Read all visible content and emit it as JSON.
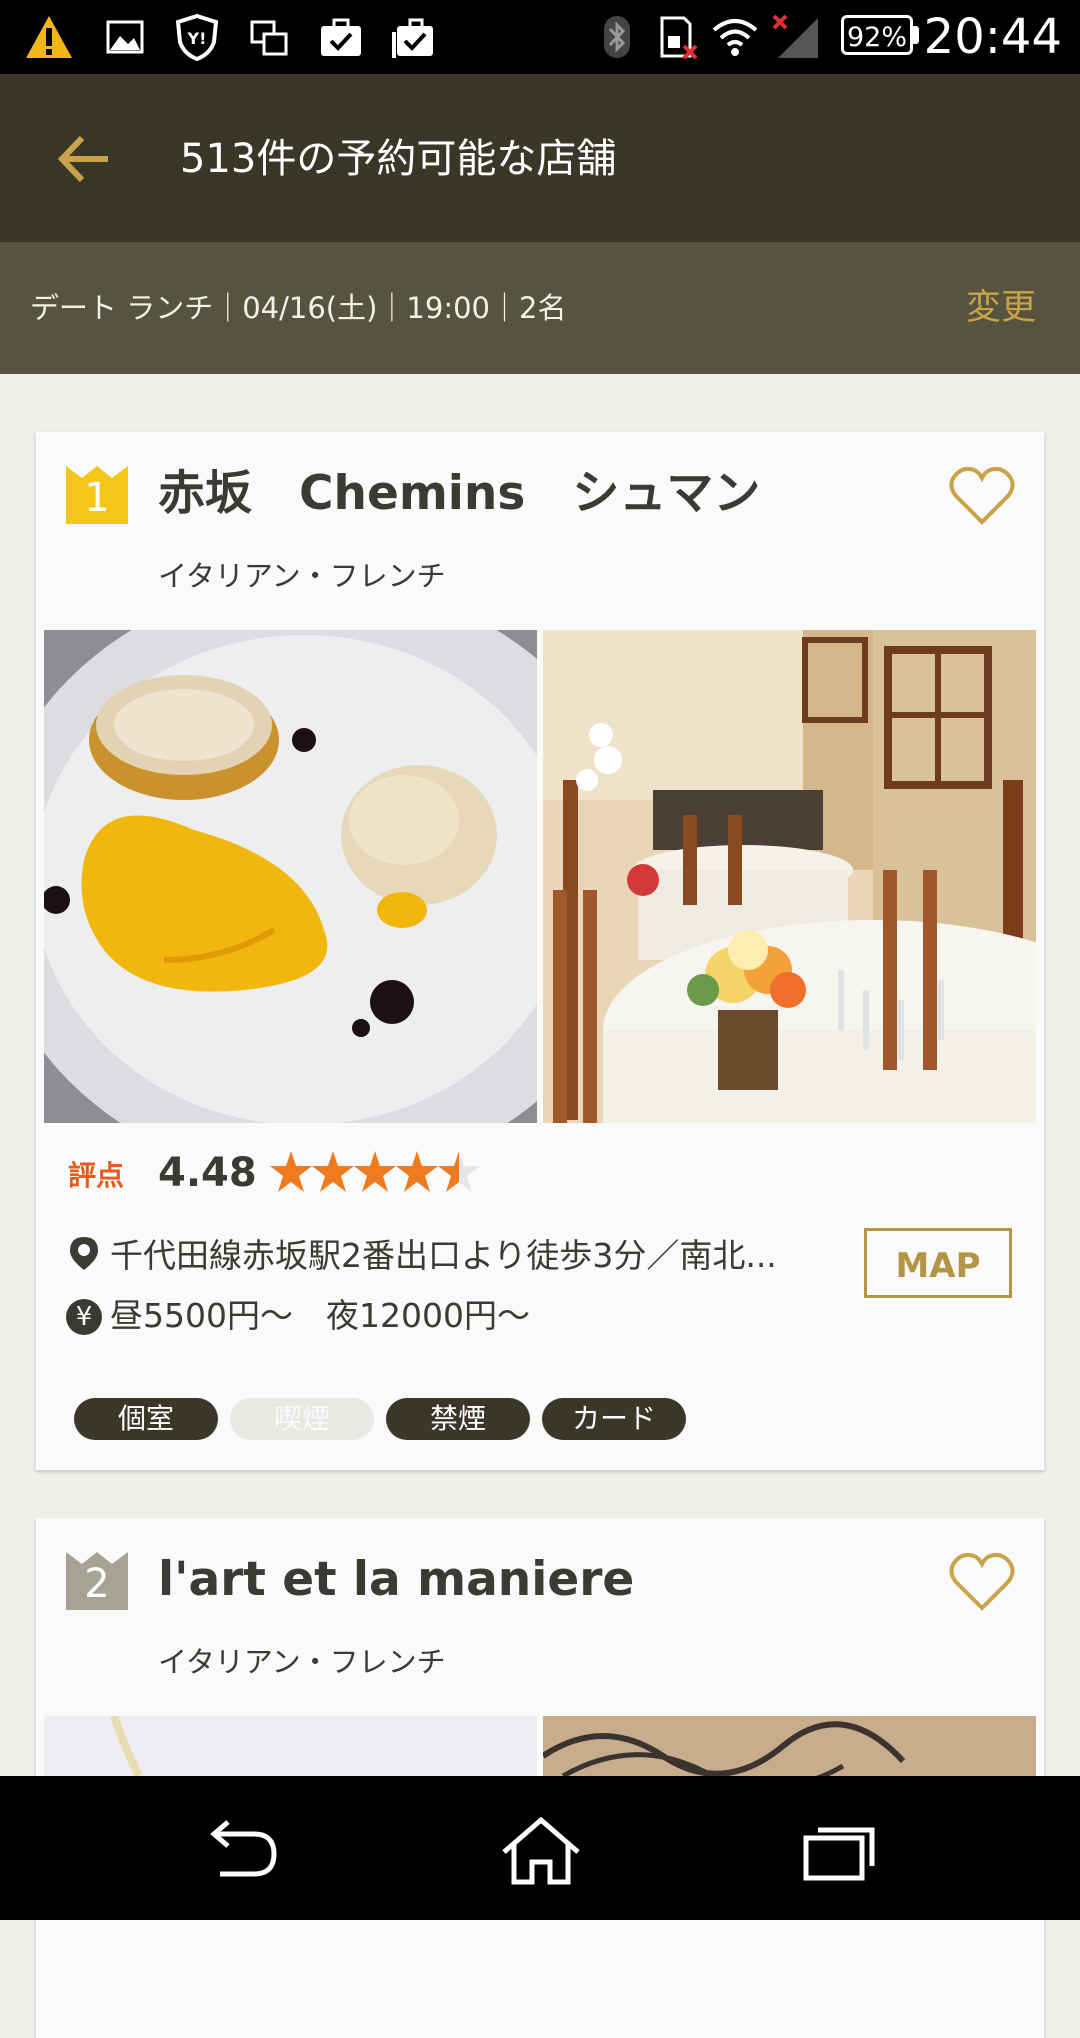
{
  "status_bar": {
    "battery": "92%",
    "time": "20:44",
    "icons": [
      "warning-icon",
      "image-icon",
      "yahoo-shield-icon",
      "screen-mirror-icon",
      "briefcase-check-icon",
      "clipboard-check-icon",
      "bluetooth-icon",
      "sd-card-error-icon",
      "wifi-icon",
      "signal-off-icon"
    ]
  },
  "app_bar": {
    "title": "513件の予約可能な店舗"
  },
  "filter_bar": {
    "summary": "デート ランチ｜04/16(土)｜19:00｜2名",
    "change_label": "変更"
  },
  "restaurants": [
    {
      "rank": "1",
      "name": "赤坂　Chemins　シュマン",
      "genre": "イタリアン・フレンチ",
      "rating_label": "評点",
      "rating": "4.48",
      "rating_value": 4.48,
      "access": "千代田線赤坂駅2番出口より徒歩3分／南北...",
      "price": "昼5500円～　夜12000円～",
      "map_label": "MAP",
      "tags": [
        {
          "label": "個室",
          "active": true
        },
        {
          "label": "喫煙",
          "active": false
        },
        {
          "label": "禁煙",
          "active": true
        },
        {
          "label": "カード",
          "active": true
        }
      ]
    },
    {
      "rank": "2",
      "name": "l'art et la maniere",
      "genre": "イタリアン・フレンチ"
    }
  ],
  "colors": {
    "app_bar": "#3a3729",
    "filter_bar": "#56533f",
    "accent_gold": "#c9a349",
    "rank1_gold": "#f5c518",
    "rank2_gray": "#a5a394",
    "rating_orange": "#e65c1e",
    "star": "#f07a1e"
  }
}
